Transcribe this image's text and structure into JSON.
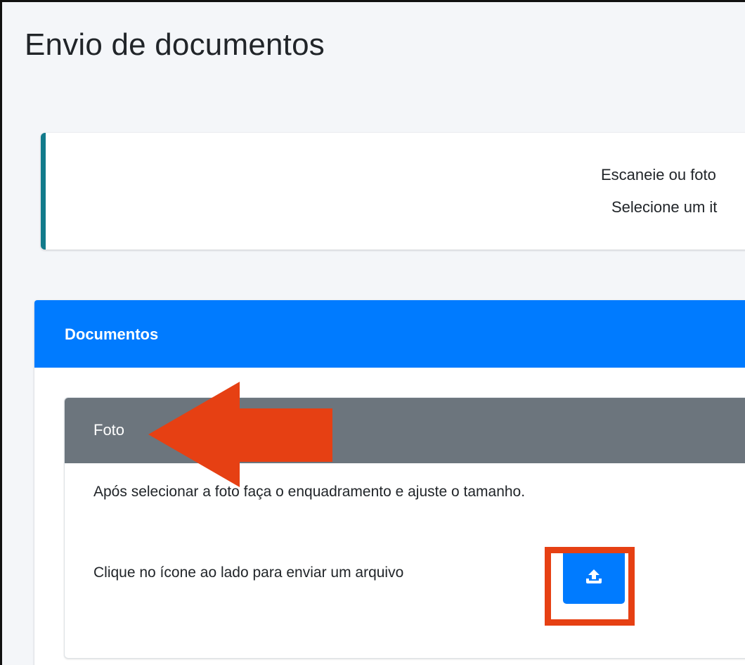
{
  "page": {
    "title": "Envio de documentos"
  },
  "info": {
    "line1": "Escaneie ou foto",
    "line2": "Selecione um it"
  },
  "documents_card": {
    "title": "Documentos"
  },
  "foto_card": {
    "title": "Foto",
    "instruction": "Após selecionar a foto faça o enquadramento e ajuste o tamanho.",
    "upload_prompt": "Clique no ícone ao lado para enviar um arquivo",
    "upload_button": {
      "icon": "upload-icon"
    }
  },
  "annotations": {
    "arrow": "left-arrow-annotation",
    "highlight": "upload-button-highlight",
    "color": "#e64013"
  },
  "colors": {
    "primary": "#007bff",
    "secondary_header": "#6c757d",
    "info_border": "#117a8b",
    "annotation": "#e64013"
  }
}
